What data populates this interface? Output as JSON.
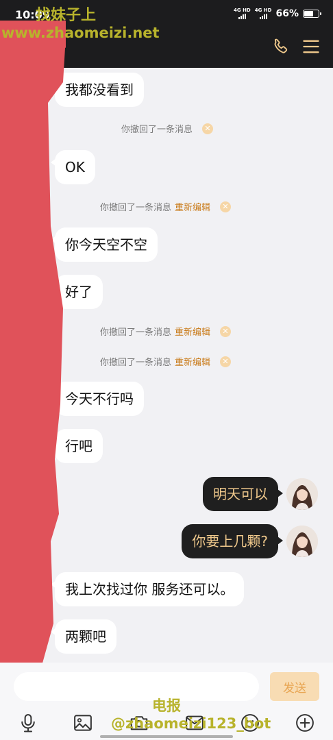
{
  "status": {
    "time": "10:09",
    "signal1": "4G HD",
    "signal2": "4G HD",
    "battery": "66%",
    "battery_fraction": 0.66
  },
  "watermarks": {
    "top_line1": "找妹子上",
    "top_line2": "www.zhaomeizi.net",
    "bottom_line1": "电报",
    "bottom_line2": "@zhaomeizi123_bot"
  },
  "messages": {
    "m1": "我都没看到",
    "r1": "你撤回了一条消息",
    "m2": "OK",
    "r2": "你撤回了一条消息",
    "r2_edit": "重新编辑",
    "m3": "你今天空不空",
    "m4": "好了",
    "r3": "你撤回了一条消息",
    "r3_edit": "重新编辑",
    "r4": "你撤回了一条消息",
    "r4_edit": "重新编辑",
    "m5": "今天不行吗",
    "m6": "行吧",
    "o1": "明天可以",
    "o2": "你要上几颗?",
    "m7": "我上次找过你 服务还可以。",
    "m8": "两颗吧"
  },
  "input": {
    "value": "",
    "send_label": "发送"
  },
  "icons": [
    "phone-icon",
    "menu-icon",
    "microphone-icon",
    "image-icon",
    "camera-icon",
    "mail-icon",
    "emoji-icon",
    "plus-icon"
  ],
  "colors": {
    "accent": "#f0c98c",
    "edit_link": "#c97a18",
    "send_bg": "#f8dcb3",
    "topbar": "#1c1c1e",
    "redaction": "#e0525a"
  }
}
